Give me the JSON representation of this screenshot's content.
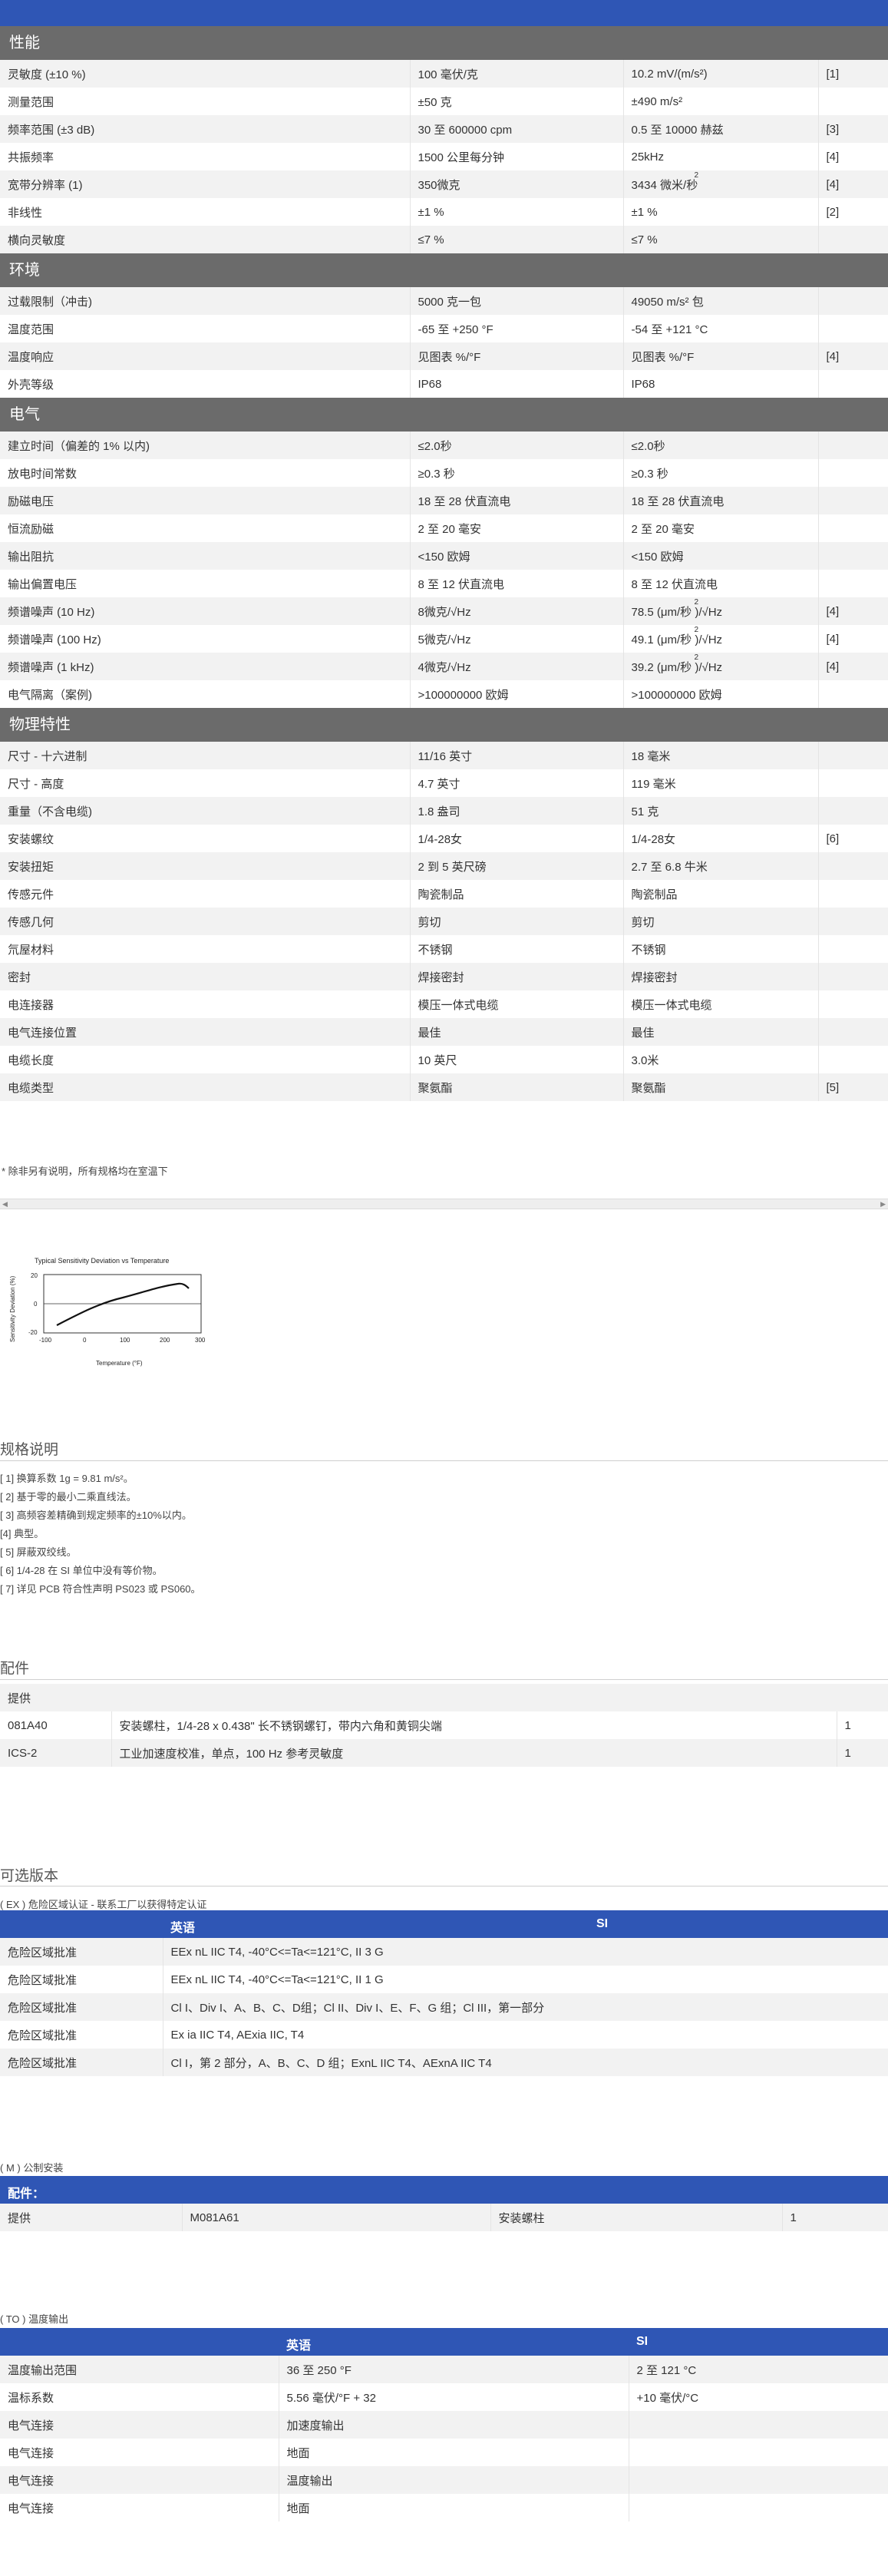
{
  "sections": [
    {
      "title": "性能",
      "rows": [
        [
          "灵敏度 (±10 %)",
          "100 毫伏/克",
          "10.2 mV/(m/s²)",
          "[1]"
        ],
        [
          "测量范围",
          "±50 克",
          "±490 m/s²",
          ""
        ],
        [
          "频率范围 (±3 dB)",
          "30 至 600000 cpm",
          "0.5 至 10000 赫兹",
          "[3]"
        ],
        [
          "共振频率",
          "1500 公里每分钟",
          "25kHz",
          "[4]"
        ],
        [
          "宽带分辨率 (1)",
          "350微克",
          "3434 微米/秒",
          "[4]"
        ],
        [
          "非线性",
          "±1 %",
          "±1 %",
          "[2]"
        ],
        [
          "横向灵敏度",
          "≤7 %",
          "≤7 %",
          ""
        ]
      ]
    },
    {
      "title": "环境",
      "rows": [
        [
          "过载限制（冲击)",
          "5000 克一包",
          "49050 m/s² 包",
          ""
        ],
        [
          "温度范围",
          "-65 至 +250 °F",
          "-54 至 +121 °C",
          ""
        ],
        [
          "温度响应",
          "见图表 %/°F",
          "见图表 %/°F",
          "[4]"
        ],
        [
          "外壳等级",
          "IP68",
          "IP68",
          ""
        ]
      ]
    },
    {
      "title": "电气",
      "rows": [
        [
          "建立时间（偏差的 1% 以内)",
          "≤2.0秒",
          "≤2.0秒",
          ""
        ],
        [
          "放电时间常数",
          "≥0.3 秒",
          "≥0.3 秒",
          ""
        ],
        [
          "励磁电压",
          "18 至 28 伏直流电",
          "18 至 28 伏直流电",
          ""
        ],
        [
          "恒流励磁",
          "2 至 20 毫安",
          "2 至 20 毫安",
          ""
        ],
        [
          "输出阻抗",
          "<150 欧姆",
          "<150 欧姆",
          ""
        ],
        [
          "输出偏置电压",
          "8 至 12 伏直流电",
          "8 至 12 伏直流电",
          ""
        ],
        [
          "频谱噪声 (10 Hz)",
          "8微克/√Hz",
          "78.5 (μm/秒 )/√Hz",
          "[4]"
        ],
        [
          "频谱噪声 (100 Hz)",
          "5微克/√Hz",
          "49.1 (μm/秒 )/√Hz",
          "[4]"
        ],
        [
          "频谱噪声 (1 kHz)",
          "4微克/√Hz",
          "39.2 (μm/秒 )/√Hz",
          "[4]"
        ],
        [
          "电气隔离（案例)",
          ">100000000 欧姆",
          ">100000000 欧姆",
          ""
        ]
      ]
    },
    {
      "title": "物理特性",
      "rows": [
        [
          "尺寸 - 十六进制",
          "11/16 英寸",
          "18 毫米",
          ""
        ],
        [
          "尺寸 - 高度",
          "4.7 英寸",
          "119 毫米",
          ""
        ],
        [
          "重量（不含电缆)",
          "1.8 盎司",
          "51 克",
          ""
        ],
        [
          "安装螺纹",
          "1/4-28女",
          "1/4-28女",
          "[6]"
        ],
        [
          "安装扭矩",
          "2 到 5 英尺磅",
          "2.7 至 6.8 牛米",
          ""
        ],
        [
          "传感元件",
          "陶瓷制品",
          "陶瓷制品",
          ""
        ],
        [
          "传感几何",
          "剪切",
          "剪切",
          ""
        ],
        [
          "氘屋材料",
          "不锈钢",
          "不锈钢",
          ""
        ],
        [
          "密封",
          "焊接密封",
          "焊接密封",
          ""
        ],
        [
          "电连接器",
          "模压一体式电缆",
          "模压一体式电缆",
          ""
        ],
        [
          "电气连接位置",
          "最佳",
          "最佳",
          ""
        ],
        [
          "电缆长度",
          "10 英尺",
          "3.0米",
          ""
        ],
        [
          "电缆类型",
          "聚氨酯",
          "聚氨酯",
          "[5]"
        ]
      ]
    }
  ],
  "superscript": "2",
  "footnote": "* 除非另有说明，所有规格均在室温下",
  "graph": {
    "title": "Typical Sensitivity Deviation vs Temperature",
    "ylabel": "Sensitivity Deviation (%)",
    "xlabel": "Temperature (°F)",
    "yticks": [
      "20",
      "0",
      "-20"
    ],
    "xticks": [
      "-100",
      "0",
      "100",
      "200",
      "300"
    ]
  },
  "spec_notes": {
    "title": "规格说明",
    "items": [
      "[ 1] 换算系数 1g = 9.81 m/s²。",
      "[ 2] 基于零的最小二乘直线法。",
      "[ 3] 高频容差精确到规定频率的±10%以内。",
      "[4] 典型。",
      "[ 5] 屏蔽双绞线。",
      "[ 6] 1/4-28 在 SI 单位中没有等价物。",
      "[ 7] 详见 PCB 符合性声明 PS023 或 PS060。"
    ]
  },
  "accessories": {
    "title": "配件",
    "header": "提供",
    "rows": [
      [
        "081A40",
        "安装螺柱，1/4-28 x 0.438\" 长不锈钢螺钉，带内六角和黄铜尖端",
        "1"
      ],
      [
        "ICS-2",
        "工业加速度校准，单点，100 Hz 参考灵敏度",
        "1"
      ]
    ]
  },
  "optional": {
    "title": "可选版本",
    "ex": {
      "caption": "( EX ) 危险区域认证 - 联系工厂以获得特定认证",
      "col_en": "英语",
      "col_si": "SI",
      "rows": [
        [
          "危险区域批准",
          "EEx nL IIC T4, -40°C<=Ta<=121°C, II 3 G"
        ],
        [
          "危险区域批准",
          "EEx nL IIC T4, -40°C<=Ta<=121°C, II 1 G"
        ],
        [
          "危险区域批准",
          "Cl I、Div I、A、B、C、D组；Cl II、Div I、E、F、G 组；Cl III，第一部分"
        ],
        [
          "危险区域批准",
          "Ex ia IIC T4, AExia IIC, T4"
        ],
        [
          "危险区域批准",
          "Cl I，第 2 部分，A、B、C、D 组；ExnL IIC T4、AExnA IIC T4"
        ]
      ]
    },
    "m": {
      "caption": "( M ) 公制安装",
      "header": "配件：",
      "row": [
        "提供",
        "M081A61",
        "安装螺柱",
        "1"
      ]
    },
    "to": {
      "caption": "( TO ) 温度输出",
      "col_en": "英语",
      "col_si": "SI",
      "rows": [
        [
          "温度输出范围",
          "36 至 250 °F",
          "2 至 121 °C"
        ],
        [
          "温标系数",
          "5.56 毫伏/°F + 32",
          "+10 毫伏/°C"
        ],
        [
          "电气连接",
          "加速度输出",
          ""
        ],
        [
          "电气连接",
          "地面",
          ""
        ],
        [
          "电气连接",
          "温度输出",
          ""
        ],
        [
          "电气连接",
          "地面",
          ""
        ]
      ]
    }
  }
}
